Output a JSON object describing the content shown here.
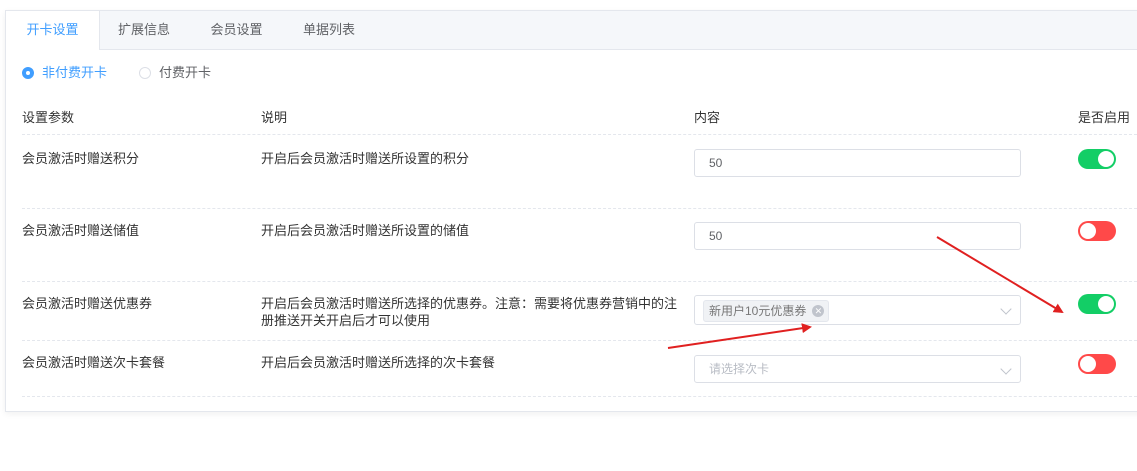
{
  "tabs": [
    {
      "label": "开卡设置",
      "active": true
    },
    {
      "label": "扩展信息",
      "active": false
    },
    {
      "label": "会员设置",
      "active": false
    },
    {
      "label": "单据列表",
      "active": false
    }
  ],
  "radio": {
    "options": [
      "非付费开卡",
      "付费开卡"
    ],
    "selected": "非付费开卡"
  },
  "table": {
    "headers": [
      "设置参数",
      "说明",
      "内容",
      "是否启用"
    ],
    "rows": [
      {
        "param": "会员激活时赠送积分",
        "desc_lines": [
          "开启后会员激活时赠送所设置的积分"
        ],
        "content_type": "input",
        "value": "50",
        "enabled": true
      },
      {
        "param": "会员激活时赠送储值",
        "desc_lines": [
          "开启后会员激活时赠送所设置的储值"
        ],
        "content_type": "input",
        "value": "50",
        "enabled": false
      },
      {
        "param": "会员激活时赠送优惠券",
        "desc_lines": [
          "开启后会员激活时赠送所选择的优惠券。注意：需要将优惠券营销中的注",
          "册推送开关开启后才可以使用"
        ],
        "content_type": "select-tags",
        "tag": "新用户10元优惠券",
        "enabled": true
      },
      {
        "param": "会员激活时赠送次卡套餐",
        "desc_lines": [
          "开启后会员激活时赠送所选择的次卡套餐"
        ],
        "content_type": "select",
        "placeholder": "请选择次卡",
        "enabled": false
      }
    ]
  },
  "colors": {
    "accent": "#409eff",
    "switch_on": "#13ce66",
    "switch_off": "#ff4949",
    "annotation_arrow": "#e02020"
  }
}
